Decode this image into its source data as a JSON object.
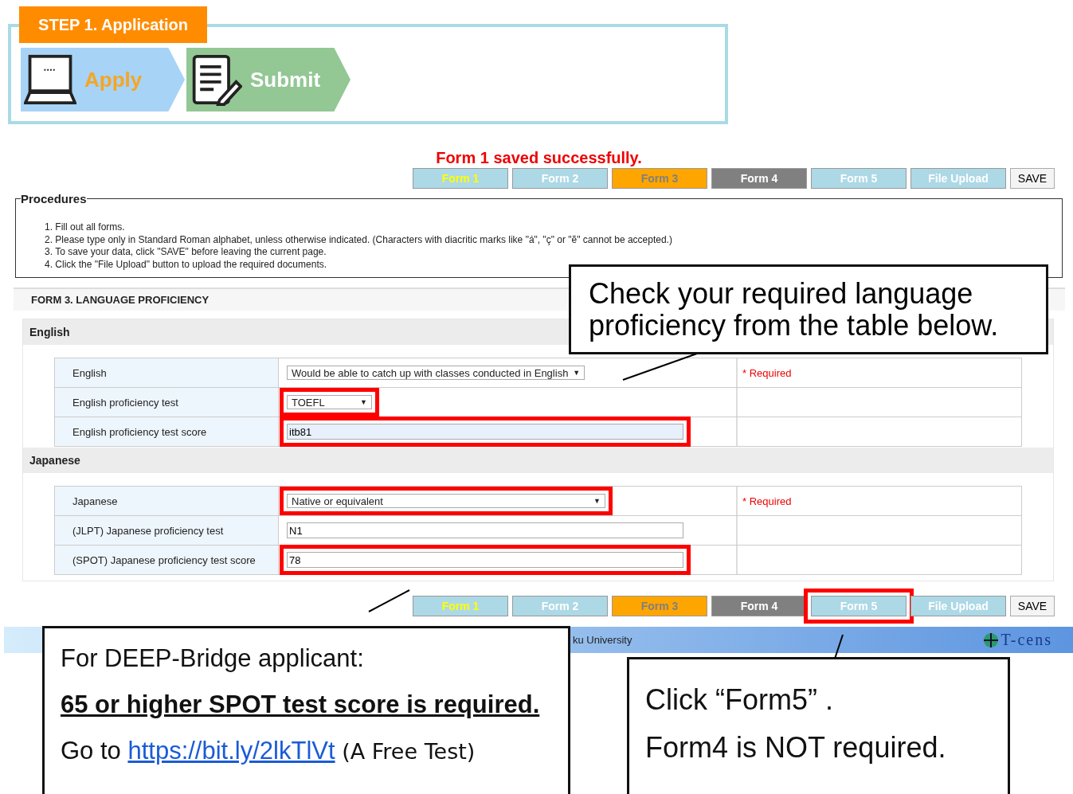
{
  "step": {
    "badge": "STEP 1. Application",
    "stages": [
      {
        "label": "Apply",
        "kind": "laptop",
        "selected": true
      },
      {
        "label": "Submit",
        "kind": "document",
        "selected": false
      }
    ]
  },
  "message": "Form 1 saved successfully.",
  "top_tabs": [
    {
      "label": "Form 1",
      "kind": "current",
      "highlighted": false
    },
    {
      "label": "Form 2",
      "kind": "normal",
      "highlighted": false
    },
    {
      "label": "Form 3",
      "kind": "attention",
      "highlighted": false
    },
    {
      "label": "Form 4",
      "kind": "dark",
      "highlighted": false
    },
    {
      "label": "Form 5",
      "kind": "normal",
      "highlighted": false
    },
    {
      "label": "File Upload",
      "kind": "normal",
      "highlighted": false
    }
  ],
  "top_save_button": "SAVE",
  "procedures": {
    "title": "Procedures",
    "items": [
      "1. Fill out all forms.",
      "2. Please type only in Standard Roman alphabet, unless otherwise indicated. (Characters with diacritic marks like \"á\", \"ç\" or \"ẽ\" cannot be accepted.)",
      "3. To save your data, click \"SAVE\" before leaving the current page.",
      "4. Click the \"File Upload\" button to upload the required documents."
    ]
  },
  "form_title": "FORM 3. LANGUAGE PROFICIENCY",
  "sections": [
    {
      "title": "English",
      "rows": [
        {
          "label": "English",
          "kind": "dropdown",
          "value": "Would be able to catch up with classes conducted in English",
          "caret": "▼",
          "required": "* Required",
          "highlighted": false
        },
        {
          "label": "English proficiency test",
          "kind": "short-dropdown",
          "value": "TOEFL",
          "caret": "▼",
          "highlighted": true
        },
        {
          "label": "English proficiency test score",
          "kind": "input",
          "value": "itb81",
          "autofilled": true,
          "highlighted": true
        }
      ]
    },
    {
      "title": "Japanese",
      "rows": [
        {
          "label": "Japanese",
          "kind": "wide-dropdown",
          "value": "Native or equivalent",
          "caret": "▼",
          "required": "* Required",
          "highlighted": true
        },
        {
          "label": "(JLPT) Japanese proficiency test",
          "kind": "input",
          "value": "N1",
          "autofilled": false,
          "highlighted": false
        },
        {
          "label": "(SPOT) Japanese proficiency test score",
          "kind": "input",
          "value": "78",
          "autofilled": false,
          "highlighted": true
        }
      ]
    }
  ],
  "bottom_tabs": [
    {
      "label": "Form 1",
      "kind": "current",
      "highlighted": false
    },
    {
      "label": "Form 2",
      "kind": "normal",
      "highlighted": false
    },
    {
      "label": "Form 3",
      "kind": "attention",
      "highlighted": false
    },
    {
      "label": "Form 4",
      "kind": "dark",
      "highlighted": false
    },
    {
      "label": "Form 5",
      "kind": "normal",
      "highlighted": true
    },
    {
      "label": "File Upload",
      "kind": "normal",
      "highlighted": false
    }
  ],
  "bottom_save_button": "SAVE",
  "footer": {
    "text": "ku University",
    "logo": "T-cens"
  },
  "callouts": {
    "table": "Check your required language proficiency from the table below.",
    "spot": {
      "line_1": "For DEEP-Bridge applicant:",
      "line_2": "65 or higher SPOT test score is required.",
      "prefix": "Go to",
      "link": "https://bit.ly/2lkTlVt",
      "suffix": "(A Free Test)"
    },
    "form5": {
      "line_1": "Click “Form5” .",
      "line_2": "Form4 is NOT required."
    }
  }
}
